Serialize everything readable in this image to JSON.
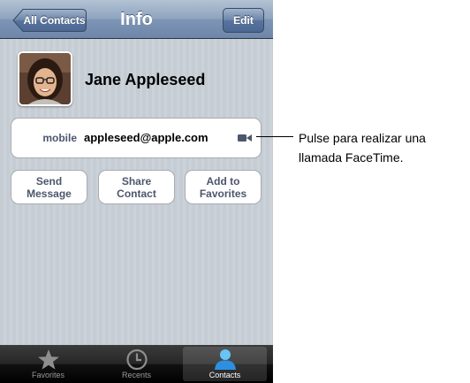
{
  "navbar": {
    "title": "Info",
    "back_label": "All Contacts",
    "edit_label": "Edit",
    "color": "#6d87aa"
  },
  "contact": {
    "name": "Jane Appleseed",
    "email_type": "mobile",
    "email": "appleseed@apple.com"
  },
  "actions": {
    "send_line1": "Send",
    "send_line2": "Message",
    "share_line1": "Share",
    "share_line2": "Contact",
    "add_line1": "Add to",
    "add_line2": "Favorites"
  },
  "tabbar": {
    "tabs": [
      {
        "label": "Favorites",
        "icon": "star-icon"
      },
      {
        "label": "Recents",
        "icon": "clock-icon"
      },
      {
        "label": "Contacts",
        "icon": "person-icon"
      }
    ],
    "active": "Contacts"
  },
  "callout": {
    "line1": "Pulse para realizar una",
    "line2": "llamada FaceTime."
  }
}
